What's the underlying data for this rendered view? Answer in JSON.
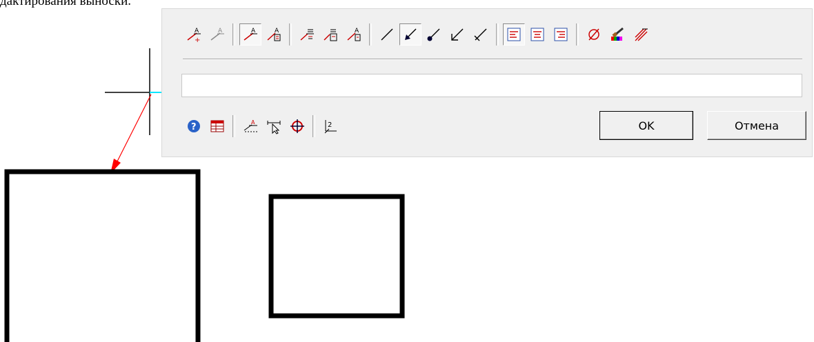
{
  "caption": "дактирования выноски.",
  "toolbar": {
    "row1_icons": [
      "leader-add-icon",
      "leader-gray-icon",
      "leader-style-icon",
      "leader-text-icon",
      "leader-text-above-icon",
      "leader-text-below-icon",
      "leader-text-right-icon",
      "line-plain-icon",
      "arrow-filled-icon",
      "dot-end-icon",
      "arrow-open-icon",
      "arrow-tick-icon",
      "align-left-icon",
      "align-center-icon",
      "align-right-icon",
      "diameter-icon",
      "color-brush-icon",
      "leader-multi-icon"
    ],
    "row2_icons": [
      "help-icon",
      "table-icon",
      "leader-shelf-icon",
      "select-cursor-icon",
      "center-mark-icon",
      "subscript-icon"
    ]
  },
  "input": {
    "value": "",
    "placeholder": ""
  },
  "buttons": {
    "ok": "OK",
    "cancel": "Отмена"
  },
  "colors": {
    "leader": "#ff0000",
    "crosshair_accent": "#00e5ff",
    "panel": "#f0f0f0"
  }
}
